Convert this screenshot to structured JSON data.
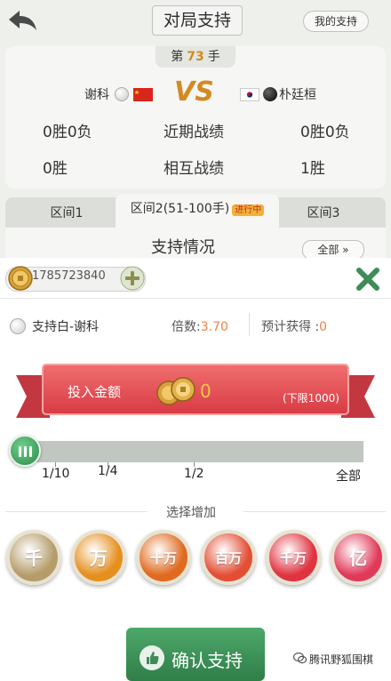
{
  "header": {
    "title": "对局支持",
    "my_support_label": "我的支持"
  },
  "match": {
    "move_prefix": "第",
    "move_number": "73",
    "move_suffix": "手",
    "player1": "谢科",
    "player2": "朴廷桓",
    "vs": "VS",
    "stats": [
      {
        "left": "0胜0负",
        "label": "近期战绩",
        "right": "0胜0负"
      },
      {
        "left": "0胜",
        "label": "相互战绩",
        "right": "1胜"
      }
    ]
  },
  "tabs": [
    {
      "label": "区间1"
    },
    {
      "label": "区间2(51-100手)",
      "badge": "进行中"
    },
    {
      "label": "区间3"
    }
  ],
  "support_section": {
    "title": "支持情况",
    "all_label": "全部 »"
  },
  "modal": {
    "balance": "1785723840",
    "choice": "支持白-谢科",
    "odds_label": "倍数:",
    "odds_value": "3.70",
    "expected_label": "预计获得 :",
    "expected_value": "0",
    "invest_label": "投入金额",
    "invest_amount": "0",
    "min_limit": "(下限1000)",
    "slider": {
      "value": 0,
      "ticks": [
        "1/10",
        "1/4",
        "1/2",
        "全部"
      ]
    },
    "section_title": "选择增加",
    "chips": [
      {
        "label": "千",
        "color": "#b59c6a"
      },
      {
        "label": "万",
        "color": "#e58f1e"
      },
      {
        "label": "十万",
        "color": "#e06a1f"
      },
      {
        "label": "百万",
        "color": "#e34e35"
      },
      {
        "label": "千万",
        "color": "#e03340"
      },
      {
        "label": "亿",
        "color": "#e03a5a"
      }
    ],
    "confirm_label": "确认支持"
  },
  "watermark": "腾讯野狐围棋"
}
